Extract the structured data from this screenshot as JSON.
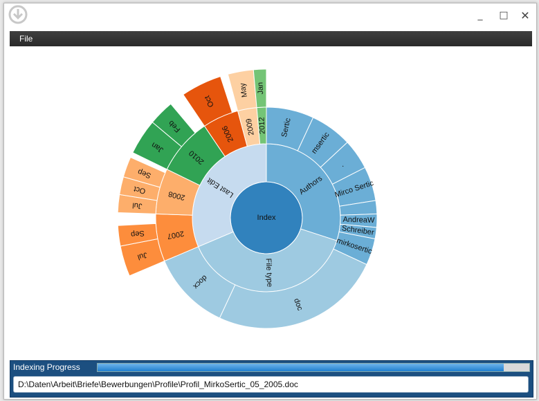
{
  "menu": {
    "file_label": "File"
  },
  "window_buttons": {
    "minimize": "_",
    "maximize": "□",
    "close": "✕"
  },
  "status": {
    "progress_label": "Indexing Progress",
    "progress_fraction": 0.94,
    "current_file": "D:\\Daten\\Arbeit\\Briefe\\Bewerbungen\\Profile\\Profil_MirkoSertic_05_2005.doc"
  },
  "chart_data": {
    "type": "sunburst",
    "center": "Index",
    "ring1": [
      {
        "label": "Authors",
        "color": "#6baed6"
      },
      {
        "label": "File type",
        "color": "#9ecae1"
      },
      {
        "label": "Last Edit",
        "color": "#c6dbef"
      }
    ],
    "ring2": [
      {
        "label": "Sertic",
        "color": "#6baed6"
      },
      {
        "label": "msertic",
        "color": "#6baed6"
      },
      {
        "label": ".",
        "color": "#6baed6"
      },
      {
        "label": "Mirco Sertic",
        "color": "#6baed6"
      },
      {
        "label": "",
        "color": "#6baed6"
      },
      {
        "label": "AndreaW",
        "color": "#6baed6"
      },
      {
        "label": "Schreiber",
        "color": "#6baed6"
      },
      {
        "label": "mirkosertic",
        "color": "#6baed6"
      },
      {
        "label": "doc",
        "color": "#9ecae1"
      },
      {
        "label": "docx",
        "color": "#9ecae1"
      },
      {
        "label": "2007",
        "color": "#fd8d3c"
      },
      {
        "label": "2008",
        "color": "#fdae6b"
      },
      {
        "label": "2010",
        "color": "#31a354"
      },
      {
        "label": "2006",
        "color": "#e6550d"
      },
      {
        "label": "2009",
        "color": "#fdd0a2"
      },
      {
        "label": "2012",
        "color": "#74c476"
      }
    ],
    "ring3": [
      {
        "label": "Jul",
        "color": "#fd8d3c"
      },
      {
        "label": "Sep",
        "color": "#fd8d3c"
      },
      {
        "label": "Jul",
        "color": "#fdae6b"
      },
      {
        "label": "Oct",
        "color": "#fdae6b"
      },
      {
        "label": "Sep",
        "color": "#fdae6b"
      },
      {
        "label": "Jan",
        "color": "#31a354"
      },
      {
        "label": "Feb",
        "color": "#31a354"
      },
      {
        "label": "Oct",
        "color": "#e6550d"
      },
      {
        "label": "May",
        "color": "#fdd0a2"
      },
      {
        "label": "Jan",
        "color": "#74c476"
      }
    ]
  }
}
